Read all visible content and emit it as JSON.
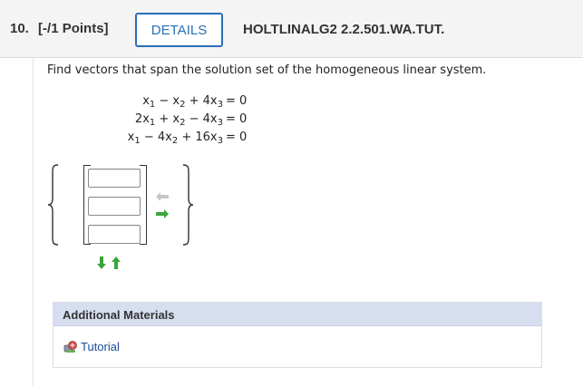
{
  "question": {
    "number_label": "10.",
    "points_label": "[-/1 Points]",
    "details_label": "DETAILS",
    "code": "HOLTLINALG2 2.2.501.WA.TUT."
  },
  "prompt": "Find vectors that span the solution set of the homogeneous linear system.",
  "equations": [
    {
      "lhs": [
        "x",
        "1",
        " − x",
        "2",
        " + 4x",
        "3"
      ],
      "rhs": "= 0"
    },
    {
      "lhs": [
        "2x",
        "1",
        " + x",
        "2",
        " − 4x",
        "3"
      ],
      "rhs": "= 0"
    },
    {
      "lhs": [
        "x",
        "1",
        " − 4x",
        "2",
        " + 16x",
        "3"
      ],
      "rhs": "= 0"
    }
  ],
  "answer": {
    "vector_values": [
      "",
      "",
      ""
    ]
  },
  "additional_materials": {
    "title": "Additional Materials",
    "tutorial_label": "Tutorial"
  },
  "colors": {
    "accent": "#2a6fb6",
    "arrow_green": "#3aa63a",
    "arrow_disabled": "#c7c7c7",
    "materials_header": "#d7def0",
    "link": "#1a4c99"
  },
  "icons": {
    "move_left": "arrow-left-icon",
    "move_right": "arrow-right-icon",
    "remove_row": "arrow-down-icon",
    "add_row": "arrow-up-icon",
    "tutorial": "tutorial-icon"
  }
}
